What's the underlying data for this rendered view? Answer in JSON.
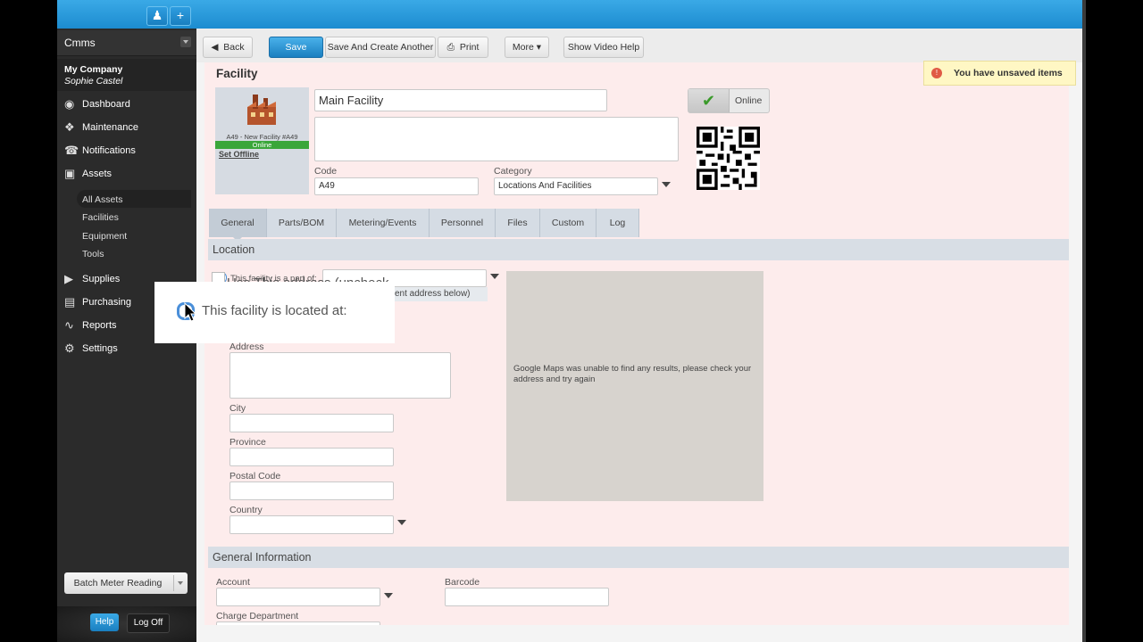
{
  "app": {
    "name": "Cmms",
    "company": "My Company",
    "user": "Sophie Castel"
  },
  "topbar": {
    "user_icon": "user-icon",
    "add_label": "+"
  },
  "sidebar": {
    "items": [
      {
        "label": "Dashboard",
        "icon": "dashboard-icon"
      },
      {
        "label": "Maintenance",
        "icon": "wrench-icon"
      },
      {
        "label": "Notifications",
        "icon": "bell-icon"
      },
      {
        "label": "Assets",
        "icon": "cubes-icon"
      }
    ],
    "asset_subitems": [
      "All Assets",
      "Facilities",
      "Equipment",
      "Tools"
    ],
    "items2": [
      {
        "label": "Supplies",
        "icon": "truck-icon"
      },
      {
        "label": "Purchasing",
        "icon": "cart-icon"
      },
      {
        "label": "Reports",
        "icon": "chart-icon"
      },
      {
        "label": "Settings",
        "icon": "gear-icon"
      }
    ],
    "batch_meter": "Batch Meter Reading",
    "help": "Help",
    "logoff": "Log Off"
  },
  "toolbar": {
    "back": "Back",
    "save": "Save",
    "save_create": "Save And Create Another",
    "print": "Print",
    "more": "More",
    "video_help": "Show Video Help"
  },
  "record": {
    "type_title": "Facility",
    "thumb_caption": "A49 - New Facility #A49",
    "status_bar": "Online",
    "set_offline": "Set Offline",
    "name": "Main Facility",
    "description": "",
    "code_label": "Code",
    "code": "A49",
    "category_label": "Category",
    "category": "Locations And Facilities",
    "online_label": "Online",
    "unsaved": "You have unsaved items"
  },
  "tabs": [
    "General",
    "Parts/BOM",
    "Metering/Events",
    "Personnel",
    "Files",
    "Custom",
    "Log"
  ],
  "location": {
    "section": "Location",
    "part_of_label": "This facility is a part of:",
    "use_address_label": "Use This address (uncheck",
    "different_address": "ent address below)",
    "located_at": "This facility is located at:",
    "address_label": "Address",
    "city_label": "City",
    "province_label": "Province",
    "postal_label": "Postal Code",
    "country_label": "Country",
    "map_message": "Google Maps was unable to find any results, please check your address and try again"
  },
  "general_info": {
    "section": "General Information",
    "account_label": "Account",
    "barcode_label": "Barcode",
    "charge_dept_label": "Charge Department"
  }
}
